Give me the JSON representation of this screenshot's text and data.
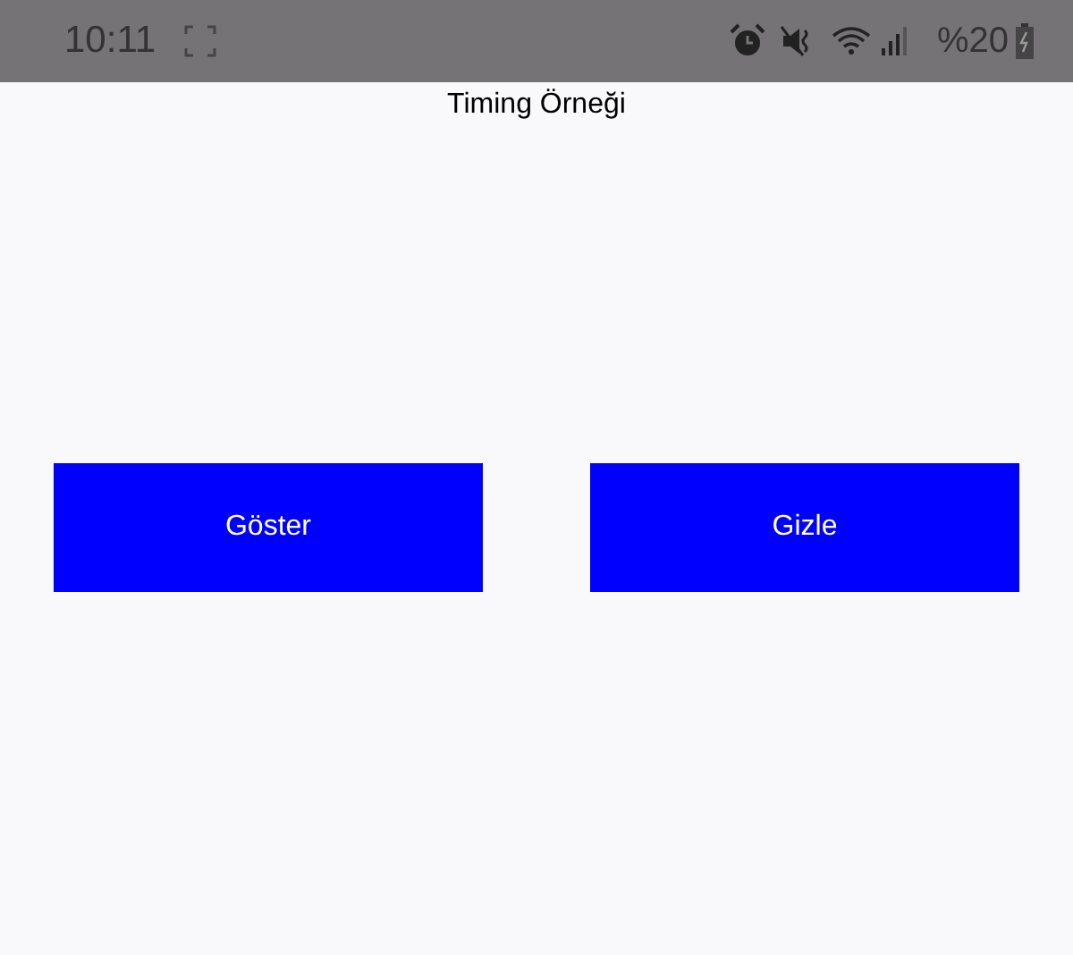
{
  "status_bar": {
    "time": "10:11",
    "battery": "%20"
  },
  "title": "Timing Örneği",
  "buttons": [
    {
      "label": "Göster"
    },
    {
      "label": "Gizle"
    }
  ]
}
